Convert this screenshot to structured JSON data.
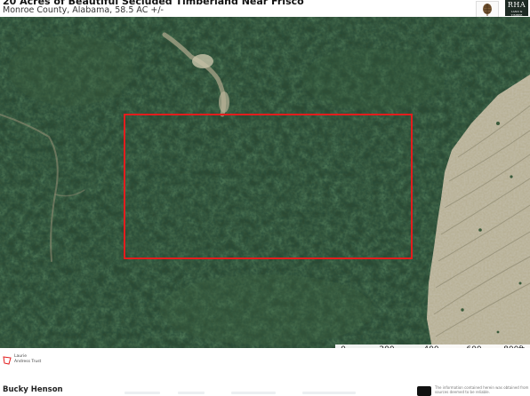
{
  "header": {
    "title": "20 Acres of Beautiful Secluded Timberland Near Frisco",
    "subtitle": "Monroe County, Alabama, 58.5 AC +/-"
  },
  "logos": {
    "pine_logo": "pine-cone-icon",
    "brand_logo_text": "RHA",
    "brand_logo_subtext": "LAND & TIMBER"
  },
  "map": {
    "boundary_color": "#e31d1d",
    "scale_unit": "ft",
    "scale_labels": [
      "0",
      "200",
      "400",
      "600",
      "800ft"
    ]
  },
  "legend": {
    "line1": "Laurie",
    "line2": "Andress Trust",
    "boundary_color": "#e31d1d"
  },
  "agent": {
    "name": "Bucky Henson"
  },
  "disclaimer": {
    "text": "The information contained herein was obtained from sources deemed to be reliable."
  }
}
